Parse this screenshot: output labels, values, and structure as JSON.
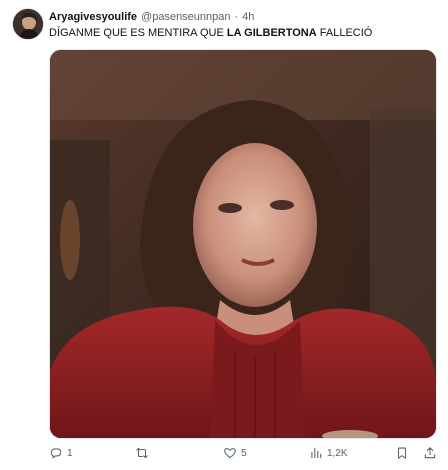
{
  "tweet": {
    "author": {
      "display_name": "Aryagivesyoulife",
      "handle": "@pasenseunnpan"
    },
    "separator": "·",
    "time": "4h",
    "text": {
      "part1": "DÍGANME QUE ES MENTIRA QUE ",
      "bold": "LA GILBERTONA",
      "part2": " FALLECIÓ"
    },
    "media": {
      "icon": "photo-of-crying-woman-in-red-dress"
    }
  },
  "actions": {
    "replies": "1",
    "retweets": "",
    "likes": "5",
    "views": "1,2K"
  },
  "colors": {
    "text": "#0f1419",
    "muted": "#536471",
    "dress": "#8e1f22"
  }
}
